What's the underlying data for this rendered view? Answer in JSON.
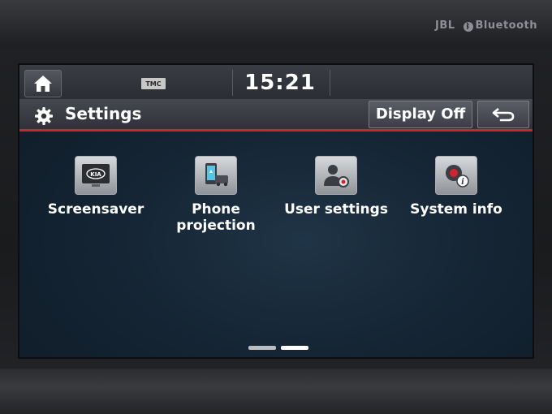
{
  "brand": {
    "audio": "JBL",
    "bluetooth": "Bluetooth"
  },
  "status_bar": {
    "tmc": "TMC",
    "time": "15:21"
  },
  "header": {
    "title": "Settings",
    "display_off_label": "Display Off"
  },
  "menu": {
    "items": [
      {
        "label": "Screensaver",
        "icon": "screensaver-icon",
        "badge": "KIA"
      },
      {
        "label": "Phone\nprojection",
        "icon": "phone-projection-icon"
      },
      {
        "label": "User settings",
        "icon": "user-settings-icon"
      },
      {
        "label": "System info",
        "icon": "system-info-icon"
      }
    ]
  },
  "pagination": {
    "pages": 2,
    "current": 2
  },
  "colors": {
    "accent": "#c0293a",
    "screen_bg": "#152534",
    "button": "#3b3e45"
  }
}
